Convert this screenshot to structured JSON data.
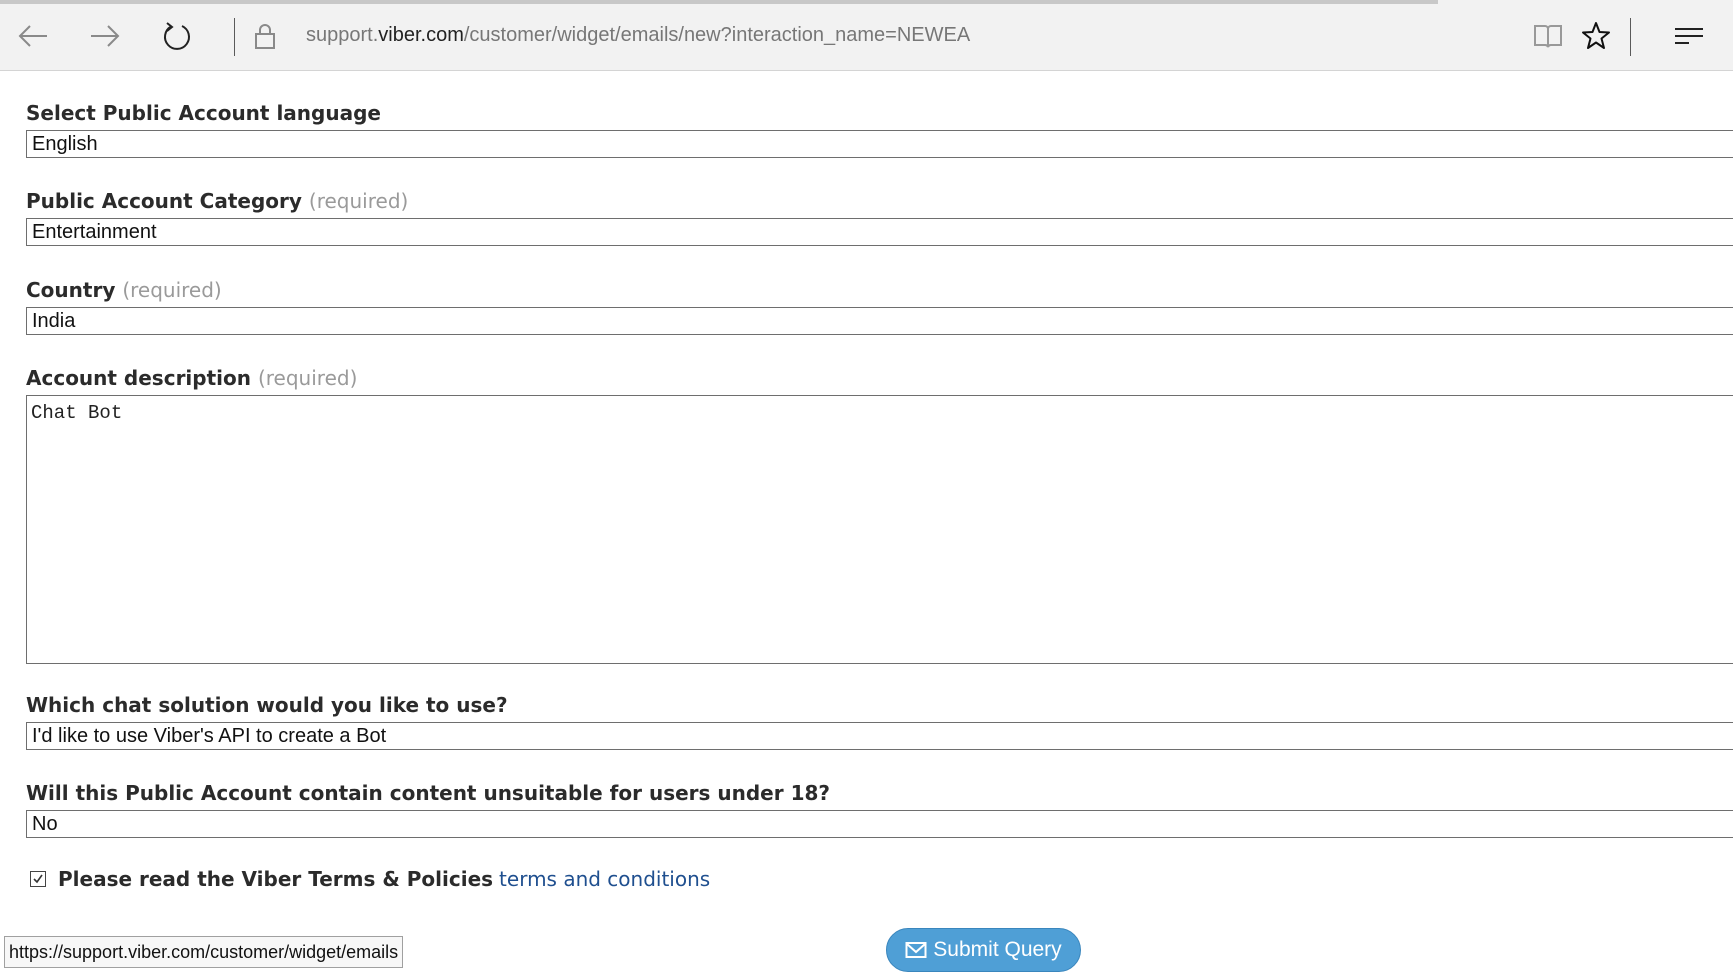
{
  "browser": {
    "load_progress": 0.83,
    "address": {
      "prefix": "support.",
      "domain": "viber.com",
      "path": "/customer/widget/emails/new?interaction_name=NEWEA"
    },
    "icons": [
      "back-arrow-icon",
      "forward-arrow-icon",
      "refresh-icon",
      "lock-icon",
      "reading-view-icon",
      "star-icon",
      "menu-icon"
    ]
  },
  "form": {
    "language": {
      "label": "Select Public Account language",
      "value": "English"
    },
    "category": {
      "label": "Public Account Category",
      "required": "(required)",
      "value": "Entertainment"
    },
    "country": {
      "label": "Country",
      "required": "(required)",
      "value": "India"
    },
    "description": {
      "label": "Account description",
      "required": "(required)",
      "value": "Chat Bot"
    },
    "chat_solution": {
      "label": "Which chat solution would you like to use?",
      "value": "I'd like to use Viber's API to create a Bot"
    },
    "adult_content": {
      "label": "Will this Public Account contain content unsuitable for users under 18?",
      "value": "No"
    },
    "terms": {
      "checked": true,
      "text": "Please read the Viber Terms & Policies",
      "link": "terms and conditions"
    },
    "submit_label": "Submit Query"
  },
  "status_url": "https://support.viber.com/customer/widget/emails"
}
